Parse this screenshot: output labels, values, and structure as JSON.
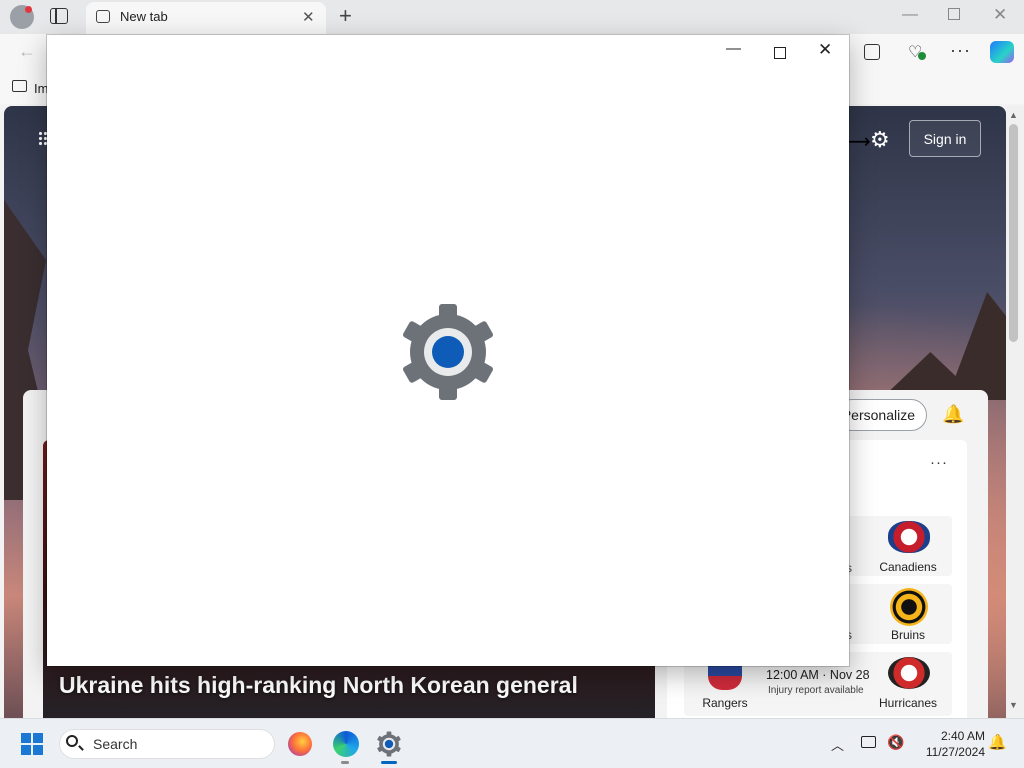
{
  "browser": {
    "tab": {
      "title": "New tab",
      "close_glyph": "✕"
    },
    "new_tab_glyph": "+",
    "window_controls": {
      "minimize": "—",
      "close": "✕"
    },
    "toolbar": {
      "back_glyph": "←",
      "more_glyph": "···",
      "health_glyph": "♡"
    },
    "favorites": {
      "first_label": "Im"
    }
  },
  "ntp": {
    "sign_in_label": "Sign in",
    "settings_glyph": "⚙",
    "cursor_glyph": "⟷",
    "personalize_label": "Personalize",
    "bell_glyph": "🔔",
    "hero_headline": "Ukraine hits high-ranking North Korean general",
    "sports": {
      "more_glyph": "···",
      "teams": {
        "canadiens": "Canadiens",
        "bruins": "Bruins",
        "rangers": "Rangers",
        "hurricanes": "Hurricanes"
      },
      "clipped_text": "s",
      "game": {
        "time": "12:00 AM · Nov 28",
        "note": "Injury report available"
      }
    },
    "scroll": {
      "up": "▲",
      "down": "▼"
    }
  },
  "settings_window": {
    "minimize_glyph": "—",
    "close_glyph": "✕",
    "icon": "settings-gear-icon",
    "colors": {
      "gear": "#6d7178",
      "accent": "#0067c0"
    }
  },
  "taskbar": {
    "search_label": "Search",
    "clock": {
      "time": "2:40 AM",
      "date": "11/27/2024"
    },
    "tray_chevron": "︿",
    "volume_glyph": "🔇",
    "bell_glyph": "🔔"
  }
}
